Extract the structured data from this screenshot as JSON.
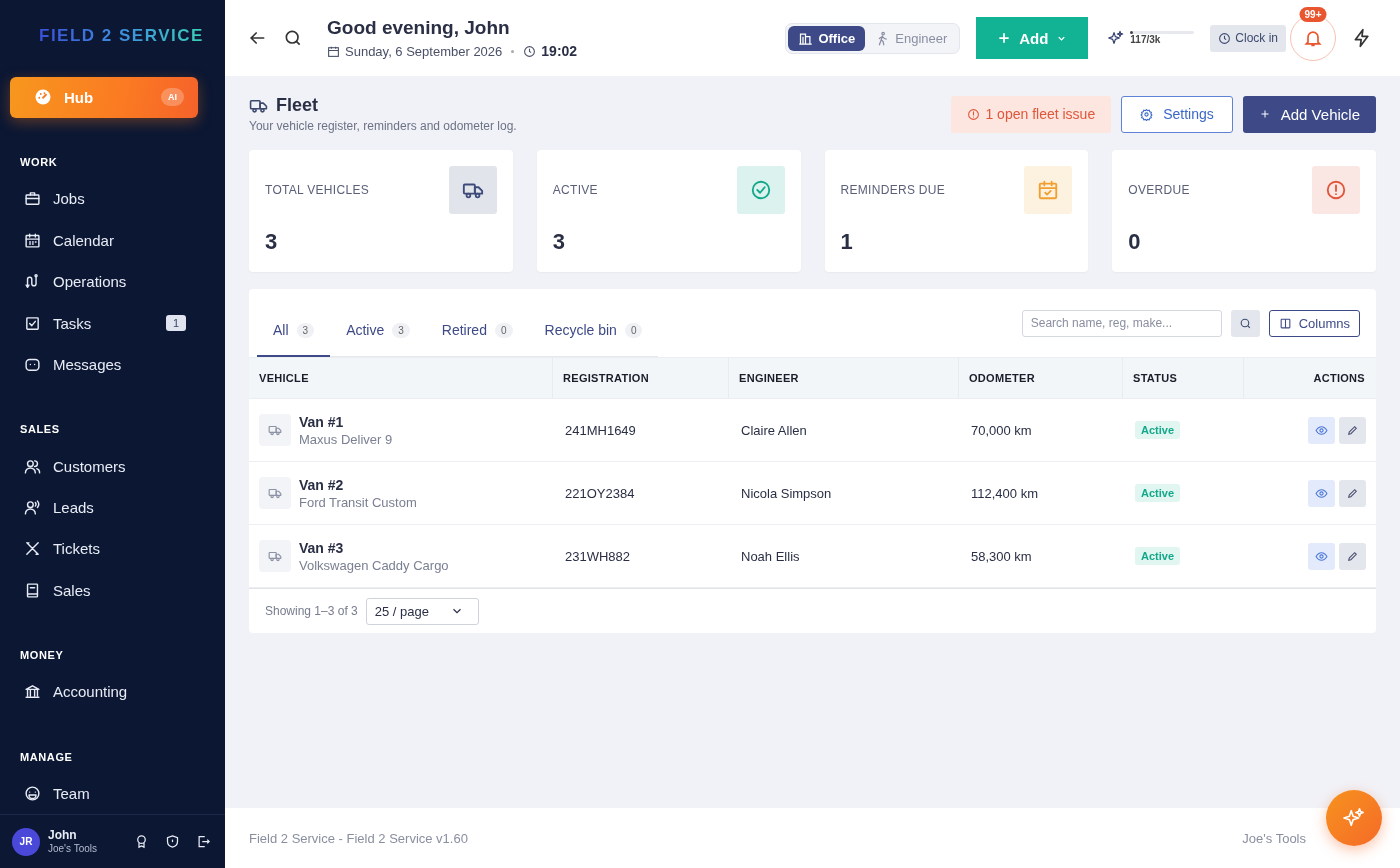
{
  "brand": {
    "logo": "FIELD 2 SERVICE"
  },
  "sidebar": {
    "hub": {
      "label": "Hub",
      "badge": "AI",
      "selected": true
    },
    "sections": [
      {
        "title": "WORK",
        "items": [
          {
            "label": "Jobs",
            "selected": false
          },
          {
            "label": "Calendar",
            "selected": false
          },
          {
            "label": "Operations",
            "selected": false
          },
          {
            "label": "Tasks",
            "badge": "1",
            "selected": false
          },
          {
            "label": "Messages",
            "selected": false
          }
        ]
      },
      {
        "title": "SALES",
        "items": [
          {
            "label": "Customers",
            "selected": false
          },
          {
            "label": "Leads",
            "selected": false
          },
          {
            "label": "Tickets",
            "selected": false
          },
          {
            "label": "Sales",
            "selected": false
          }
        ]
      },
      {
        "title": "MONEY",
        "items": [
          {
            "label": "Accounting",
            "selected": false
          }
        ]
      },
      {
        "title": "MANAGE",
        "items": [
          {
            "label": "Team",
            "selected": false
          }
        ]
      }
    ],
    "user": {
      "initials": "JR",
      "name": "John",
      "company": "Joe's Tools"
    }
  },
  "topbar": {
    "greeting": "Good evening, John",
    "date": "Sunday, 6 September 2026",
    "time": "19:02",
    "modes": [
      {
        "label": "Office",
        "selected": true
      },
      {
        "label": "Engineer",
        "selected": false
      }
    ],
    "add_button": "Add",
    "usage": {
      "reading": "117/3k",
      "level": 0.04
    },
    "clock_in": "Clock in",
    "notifications": "99+"
  },
  "page": {
    "title": "Fleet",
    "subtitle": "Your vehicle register, reminders and odometer log.",
    "alert": "1 open fleet issue",
    "settings": "Settings",
    "add_vehicle": "Add Vehicle"
  },
  "stats": [
    {
      "label": "TOTAL VEHICLES",
      "value": "3",
      "color": "#3d4a7a"
    },
    {
      "label": "ACTIVE",
      "value": "3",
      "color": "#14a88a"
    },
    {
      "label": "REMINDERS DUE",
      "value": "1",
      "color": "#f0a030"
    },
    {
      "label": "OVERDUE",
      "value": "0",
      "color": "#e0563a"
    }
  ],
  "tabs": [
    {
      "label": "All",
      "count": "3",
      "selected": true
    },
    {
      "label": "Active",
      "count": "3",
      "selected": false
    },
    {
      "label": "Retired",
      "count": "0",
      "selected": false
    },
    {
      "label": "Recycle bin",
      "count": "0",
      "selected": false
    }
  ],
  "search": {
    "placeholder": "Search name, reg, make..."
  },
  "columns_button": "Columns",
  "table": {
    "columns": [
      "VEHICLE",
      "REGISTRATION",
      "ENGINEER",
      "ODOMETER",
      "STATUS",
      "ACTIONS"
    ],
    "rows": [
      {
        "name": "Van #1",
        "model": "Maxus Deliver 9",
        "registration": "241MH1649",
        "engineer": "Claire Allen",
        "odometer": "70,000 km",
        "status": {
          "label": "Active",
          "kind": "active"
        }
      },
      {
        "name": "Van #2",
        "model": "Ford Transit Custom",
        "registration": "221OY2384",
        "engineer": "Nicola Simpson",
        "odometer": "112,400 km",
        "status": {
          "label": "Active",
          "kind": "active"
        }
      },
      {
        "name": "Van #3",
        "model": "Volkswagen Caddy Cargo",
        "registration": "231WH882",
        "engineer": "Noah Ellis",
        "odometer": "58,300 km",
        "status": {
          "label": "Active",
          "kind": "active"
        }
      }
    ]
  },
  "pagination": {
    "summary": "Showing 1–3 of 3",
    "page_size": "25 / page"
  },
  "footer": {
    "left": "Field 2 Service - Field 2 Service v1.60",
    "right": "Joe's Tools"
  }
}
